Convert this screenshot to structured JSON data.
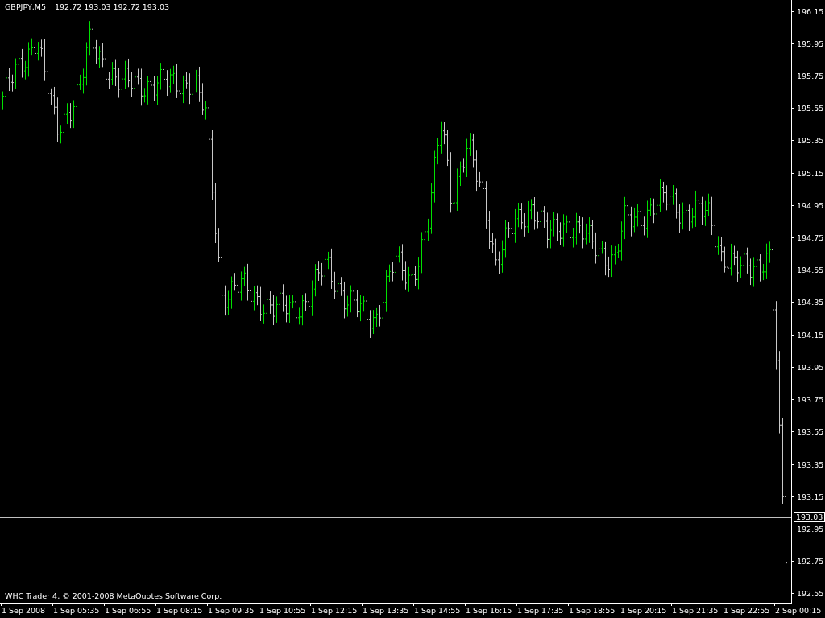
{
  "chart": {
    "symbol": "GBPJPY,M5",
    "quotes": "192.72 193.03 192.72 193.03",
    "copyright": "WHC Trader 4, © 2001-2008 MetaQuotes Software Corp.",
    "current_price": "193.03"
  },
  "price_axis": [
    "196.15",
    "195.95",
    "195.75",
    "195.55",
    "195.35",
    "195.15",
    "194.95",
    "194.75",
    "194.55",
    "194.35",
    "194.15",
    "193.95",
    "193.75",
    "193.55",
    "193.35",
    "193.15",
    "192.95",
    "192.75",
    "192.55"
  ],
  "time_axis": [
    "1 Sep 2008",
    "1 Sep 05:35",
    "1 Sep 06:55",
    "1 Sep 08:15",
    "1 Sep 09:35",
    "1 Sep 10:55",
    "1 Sep 12:15",
    "1 Sep 13:35",
    "1 Sep 14:55",
    "1 Sep 16:15",
    "1 Sep 17:35",
    "1 Sep 18:55",
    "1 Sep 20:15",
    "1 Sep 21:35",
    "1 Sep 22:55",
    "2 Sep 00:15"
  ]
}
